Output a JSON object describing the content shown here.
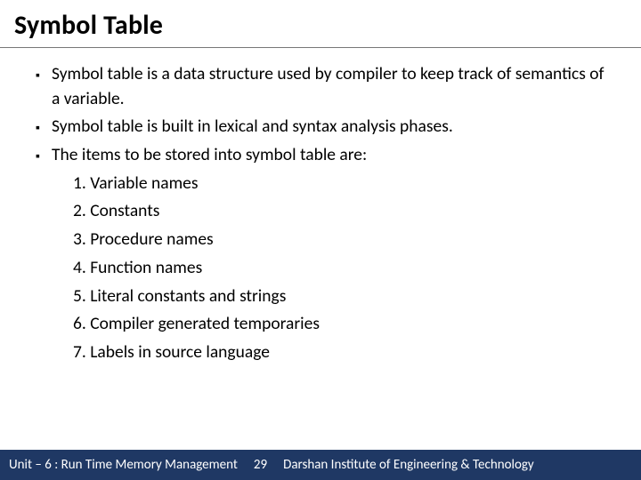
{
  "title": "Symbol Table",
  "bullets": [
    "Symbol table is a data structure used by compiler to keep track of semantics of a variable.",
    "Symbol table is built in lexical and syntax analysis phases.",
    "The items to be stored into symbol table are:"
  ],
  "numbered": [
    "Variable names",
    "Constants",
    "Procedure names",
    "Function names",
    "Literal constants and strings",
    "Compiler generated temporaries",
    "Labels in source language"
  ],
  "num_prefix": {
    "n1": "1. ",
    "n2": "2. ",
    "n3": "3. ",
    "n4": "4. ",
    "n5": "5. ",
    "n6": "6. ",
    "n7": "7. "
  },
  "footer": {
    "unit": "Unit – 6 : Run Time Memory Management",
    "page": "29",
    "institute": "Darshan Institute of Engineering & Technology"
  }
}
